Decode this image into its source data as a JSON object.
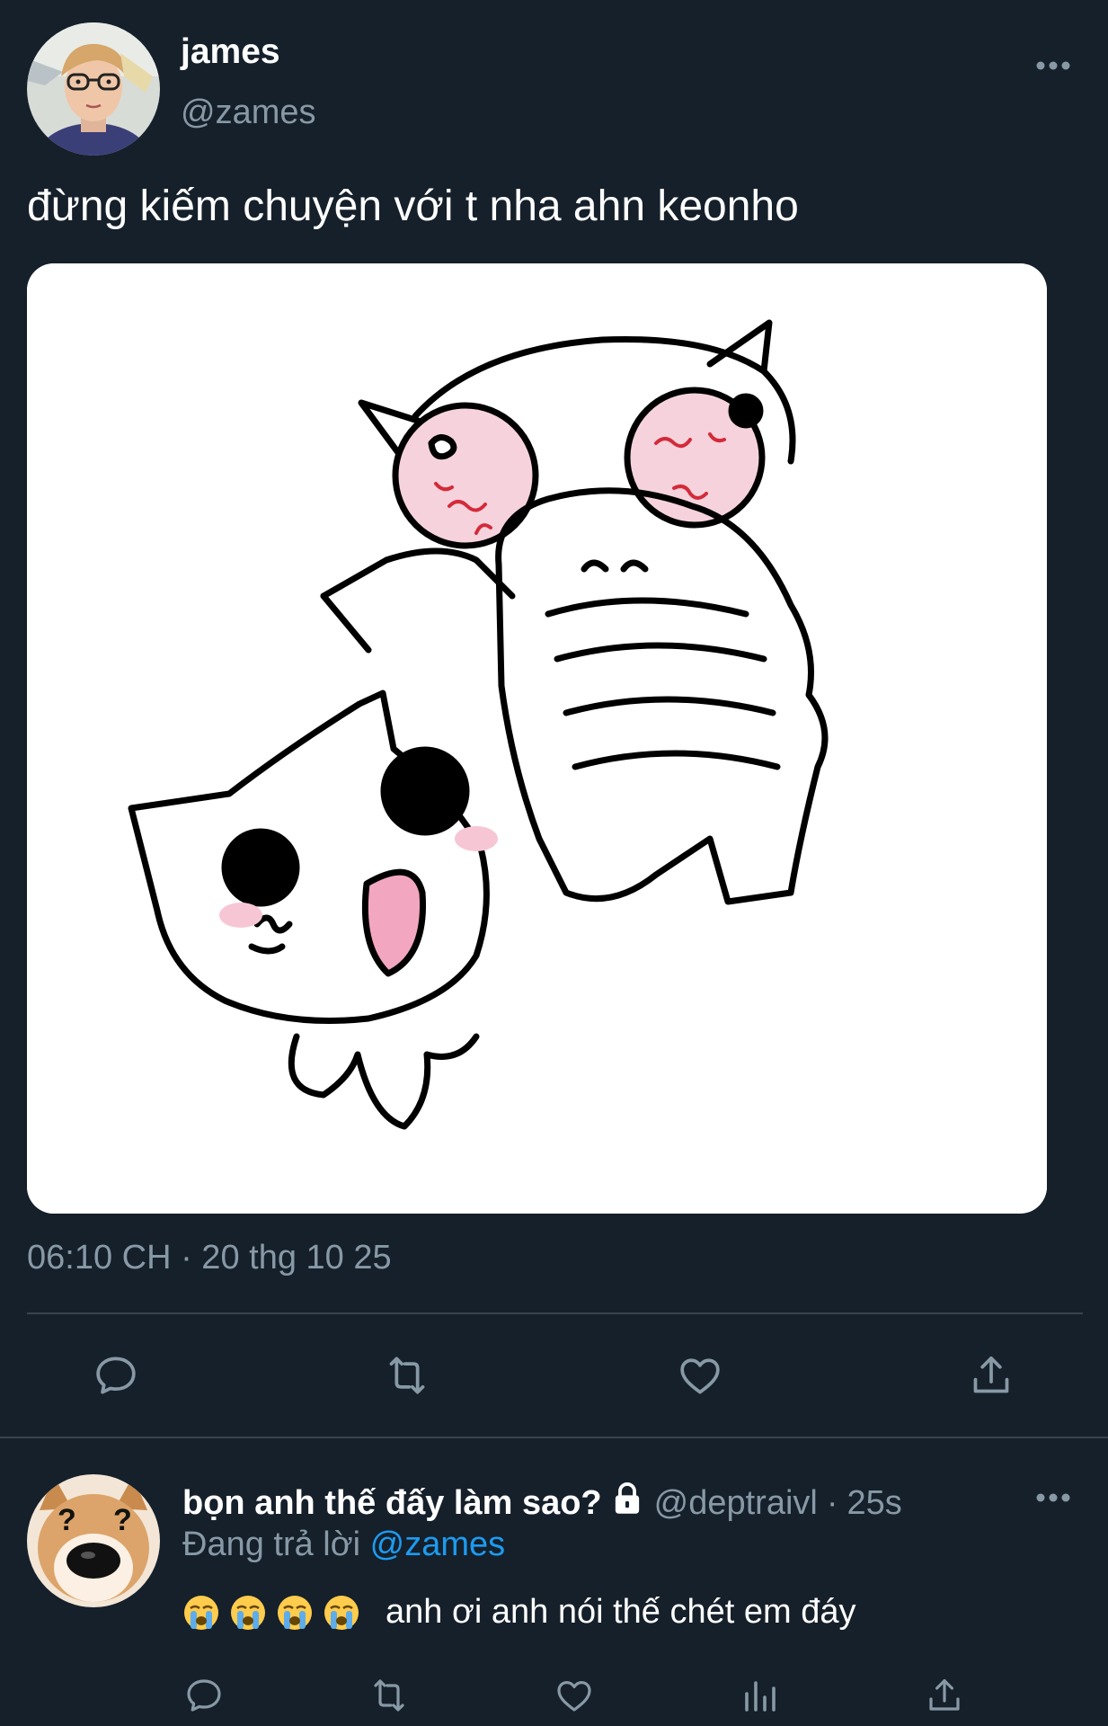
{
  "tweet": {
    "author": {
      "display_name": "james",
      "handle": "@zames",
      "avatar": "profile-photo-boy-glasses"
    },
    "text": "đừng kiếm chuyện với t nha ahn keonho",
    "media": "cartoon-cats-drawing",
    "timestamp": "06:10 CH · 20 thg 10 25",
    "actions": [
      "reply-icon",
      "retweet-icon",
      "like-icon",
      "share-icon"
    ]
  },
  "reply": {
    "author": {
      "display_name": "bọn anh thế đấy làm sao?",
      "handle": "@deptraivl",
      "time": "25s",
      "separator": "·",
      "avatar": "dog-question-marks",
      "locked_icon": "lock-icon"
    },
    "replying_prefix": "Đang trả lời",
    "replying_to": "@zames",
    "emoji": [
      "crying-face-emoji",
      "crying-face-emoji",
      "crying-face-emoji",
      "crying-face-emoji"
    ],
    "text": "anh ơi anh nói thế chét em đáy",
    "actions": [
      "reply-icon",
      "retweet-icon",
      "like-icon",
      "analytics-icon",
      "share-icon"
    ]
  },
  "colors": {
    "background": "#15202b",
    "secondary_text": "#8899a6",
    "accent": "#1d9bf0",
    "divider": "#38444d"
  }
}
